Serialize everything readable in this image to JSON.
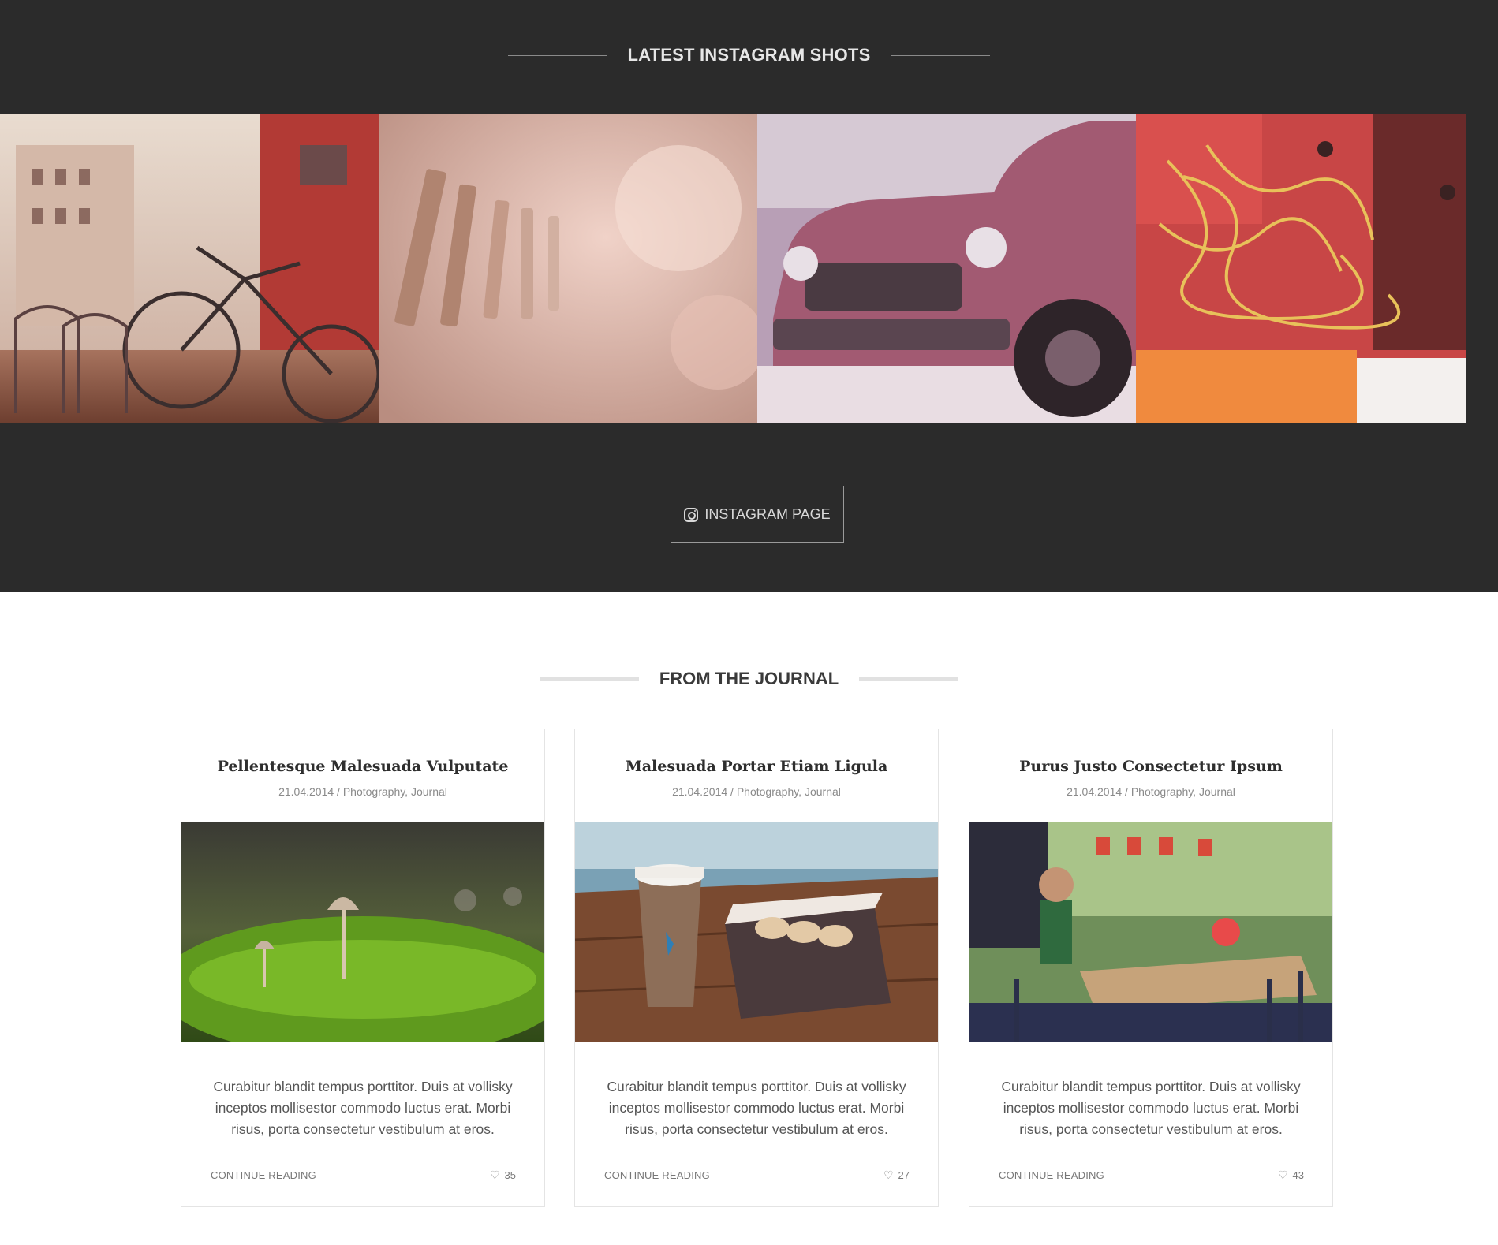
{
  "instagram": {
    "heading": "LATEST INSTAGRAM SHOTS",
    "photos": [
      {
        "icon": "photo-bicycle"
      },
      {
        "icon": "photo-clothespins"
      },
      {
        "icon": "photo-old-truck"
      },
      {
        "icon": "photo-wires"
      }
    ],
    "button_label": "INSTAGRAM PAGE"
  },
  "journal": {
    "heading": "FROM THE JOURNAL",
    "posts": [
      {
        "title": "Pellentesque Malesuada Vulputate",
        "meta": "21.04.2014 / Photography, Journal",
        "image": "photo-mushroom-moss",
        "excerpt": "Curabitur blandit tempus porttitor. Duis at vollisky inceptos mollisestor commodo luctus erat. Morbi risus, porta consectetur vestibulum at eros.",
        "continue_label": "CONTINUE READING",
        "likes": "35"
      },
      {
        "title": "Malesuada Portar Etiam Ligula",
        "meta": "21.04.2014 / Photography, Journal",
        "image": "photo-coffee-macarons",
        "excerpt": "Curabitur blandit tempus porttitor. Duis at vollisky inceptos mollisestor commodo luctus erat. Morbi risus, porta consectetur vestibulum at eros.",
        "continue_label": "CONTINUE READING",
        "likes": "27"
      },
      {
        "title": "Purus Justo Consectetur Ipsum",
        "meta": "21.04.2014 / Photography, Journal",
        "image": "photo-cafe-terrace",
        "excerpt": "Curabitur blandit tempus porttitor. Duis at vollisky inceptos mollisestor commodo luctus erat. Morbi risus, porta consectetur vestibulum at eros.",
        "continue_label": "CONTINUE READING",
        "likes": "43"
      }
    ]
  },
  "colors": {
    "dark_bg": "#2b2b2b",
    "heading_light": "#e6e6e6",
    "heading_dark": "#3a3a3a",
    "rule_light": "#e1e1e1"
  }
}
